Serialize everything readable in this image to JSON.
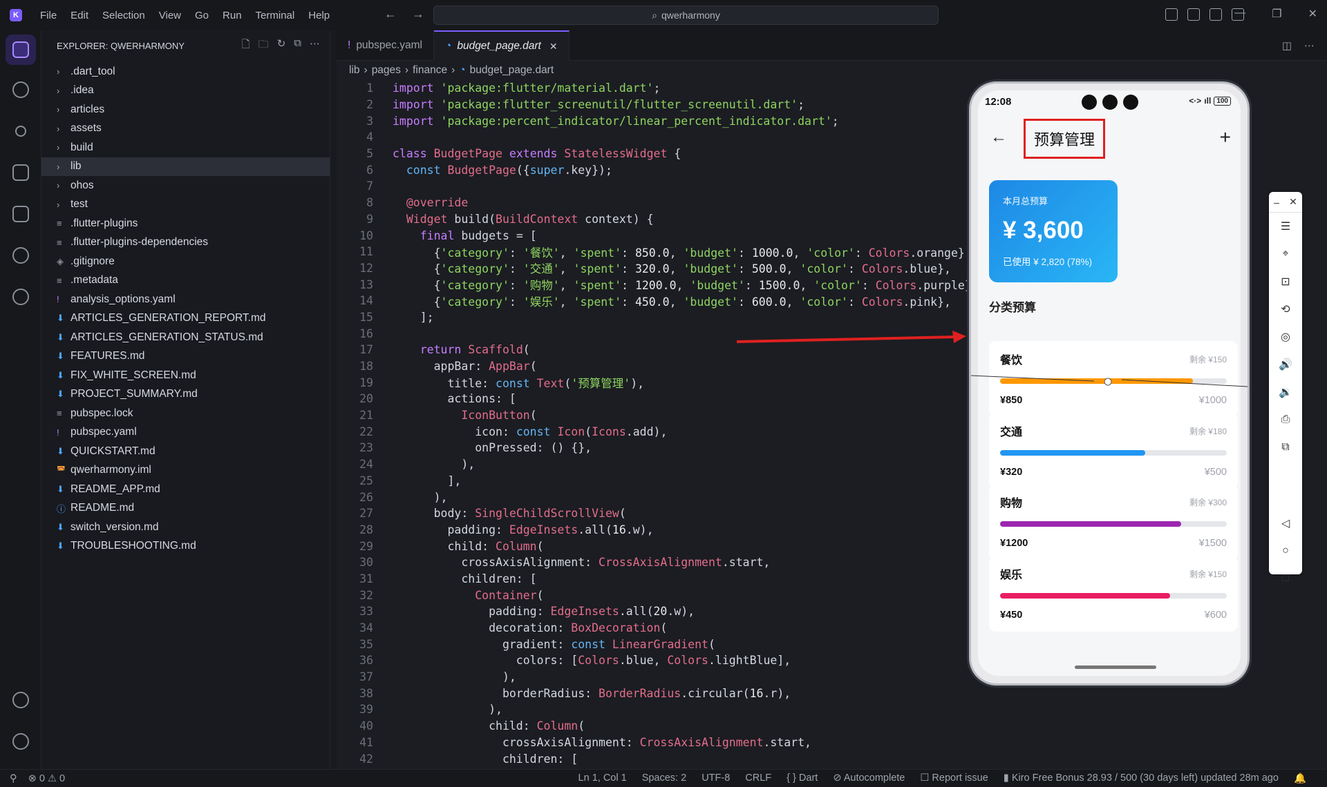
{
  "menu": [
    "File",
    "Edit",
    "Selection",
    "View",
    "Go",
    "Run",
    "Terminal",
    "Help"
  ],
  "search": {
    "text": "qwerharmony"
  },
  "explorer": {
    "title": "EXPLORER: QWERHARMONY",
    "items": [
      {
        "label": ".dart_tool",
        "type": "folder"
      },
      {
        "label": ".idea",
        "type": "folder"
      },
      {
        "label": "articles",
        "type": "folder"
      },
      {
        "label": "assets",
        "type": "folder"
      },
      {
        "label": "build",
        "type": "folder"
      },
      {
        "label": "lib",
        "type": "folder"
      },
      {
        "label": "ohos",
        "type": "folder"
      },
      {
        "label": "test",
        "type": "folder"
      },
      {
        "label": ".flutter-plugins",
        "type": "txt"
      },
      {
        "label": ".flutter-plugins-dependencies",
        "type": "txt"
      },
      {
        "label": ".gitignore",
        "type": "git"
      },
      {
        "label": ".metadata",
        "type": "txt"
      },
      {
        "label": "analysis_options.yaml",
        "type": "yaml"
      },
      {
        "label": "ARTICLES_GENERATION_REPORT.md",
        "type": "md"
      },
      {
        "label": "ARTICLES_GENERATION_STATUS.md",
        "type": "md"
      },
      {
        "label": "FEATURES.md",
        "type": "md"
      },
      {
        "label": "FIX_WHITE_SCREEN.md",
        "type": "md"
      },
      {
        "label": "PROJECT_SUMMARY.md",
        "type": "md"
      },
      {
        "label": "pubspec.lock",
        "type": "txt"
      },
      {
        "label": "pubspec.yaml",
        "type": "yaml"
      },
      {
        "label": "QUICKSTART.md",
        "type": "md"
      },
      {
        "label": "qwerharmony.iml",
        "type": "xml"
      },
      {
        "label": "README_APP.md",
        "type": "md"
      },
      {
        "label": "README.md",
        "type": "info"
      },
      {
        "label": "switch_version.md",
        "type": "md"
      },
      {
        "label": "TROUBLESHOOTING.md",
        "type": "md"
      }
    ]
  },
  "tabs": [
    {
      "label": "pubspec.yaml",
      "active": false
    },
    {
      "label": "budget_page.dart",
      "active": true
    }
  ],
  "breadcrumb": [
    "lib",
    "pages",
    "finance",
    "budget_page.dart"
  ],
  "code_lines": [
    "import 'package:flutter/material.dart';",
    "import 'package:flutter_screenutil/flutter_screenutil.dart';",
    "import 'package:percent_indicator/linear_percent_indicator.dart';",
    "",
    "class BudgetPage extends StatelessWidget {",
    "  const BudgetPage({super.key});",
    "",
    "  @override",
    "  Widget build(BuildContext context) {",
    "    final budgets = [",
    "      {'category': '餐饮', 'spent': 850.0, 'budget': 1000.0, 'color': Colors.orange},",
    "      {'category': '交通', 'spent': 320.0, 'budget': 500.0, 'color': Colors.blue},",
    "      {'category': '购物', 'spent': 1200.0, 'budget': 1500.0, 'color': Colors.purple},",
    "      {'category': '娱乐', 'spent': 450.0, 'budget': 600.0, 'color': Colors.pink},",
    "    ];",
    "",
    "    return Scaffold(",
    "      appBar: AppBar(",
    "        title: const Text('预算管理'),",
    "        actions: [",
    "          IconButton(",
    "            icon: const Icon(Icons.add),",
    "            onPressed: () {},",
    "          ),",
    "        ],",
    "      ),",
    "      body: SingleChildScrollView(",
    "        padding: EdgeInsets.all(16.w),",
    "        child: Column(",
    "          crossAxisAlignment: CrossAxisAlignment.start,",
    "          children: [",
    "            Container(",
    "              padding: EdgeInsets.all(20.w),",
    "              decoration: BoxDecoration(",
    "                gradient: const LinearGradient(",
    "                  colors: [Colors.blue, Colors.lightBlue],",
    "                ),",
    "                borderRadius: BorderRadius.circular(16.r),",
    "              ),",
    "              child: Column(",
    "                crossAxisAlignment: CrossAxisAlignment.start,",
    "                children: ["
  ],
  "phone": {
    "time": "12:08",
    "battery": "100",
    "title": "预算管理",
    "total_label": "本月总预算",
    "total_amount": "¥ 3,600",
    "total_used": "已使用 ¥ 2,820 (78%)",
    "section_title": "分类预算",
    "categories": [
      {
        "name": "餐饮",
        "remaining": "剩余 ¥150",
        "spent": "¥850",
        "budget": "¥1000",
        "progress": 0.85,
        "color": "#ff9800"
      },
      {
        "name": "交通",
        "remaining": "剩余 ¥180",
        "spent": "¥320",
        "budget": "¥500",
        "progress": 0.64,
        "color": "#2196f3"
      },
      {
        "name": "购物",
        "remaining": "剩余 ¥300",
        "spent": "¥1200",
        "budget": "¥1500",
        "progress": 0.8,
        "color": "#9c27b0"
      },
      {
        "name": "娱乐",
        "remaining": "剩余 ¥150",
        "spent": "¥450",
        "budget": "¥600",
        "progress": 0.75,
        "color": "#e91e63"
      }
    ]
  },
  "status": {
    "errors": "0",
    "warnings": "0",
    "position": "Ln 1, Col 1",
    "spaces": "Spaces: 2",
    "encoding": "UTF-8",
    "eol": "CRLF",
    "language": "Dart",
    "autocomplete": "Autocomplete",
    "report": "Report issue",
    "bonus": "Kiro Free Bonus 28.93 / 500 (30 days left) updated 28m ago"
  },
  "colors": {
    "accent": "#7c5cff",
    "highlight": "#e02020"
  }
}
